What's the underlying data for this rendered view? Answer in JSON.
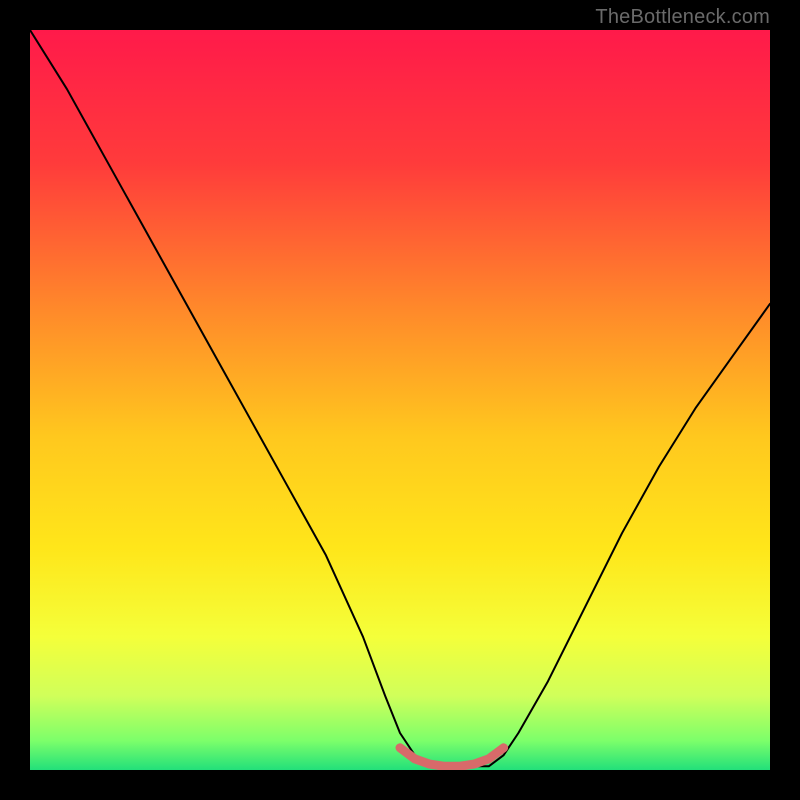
{
  "watermark": "TheBottleneck.com",
  "chart_data": {
    "type": "line",
    "title": "",
    "xlabel": "",
    "ylabel": "",
    "xlim": [
      0,
      100
    ],
    "ylim": [
      0,
      100
    ],
    "series": [
      {
        "name": "bottleneck-curve",
        "color": "#000000",
        "x": [
          0,
          5,
          10,
          15,
          20,
          25,
          30,
          35,
          40,
          45,
          48,
          50,
          52,
          55,
          58,
          60,
          62,
          64,
          66,
          70,
          75,
          80,
          85,
          90,
          95,
          100
        ],
        "y": [
          100,
          92,
          83,
          74,
          65,
          56,
          47,
          38,
          29,
          18,
          10,
          5,
          2,
          0.5,
          0.5,
          0.5,
          0.5,
          2,
          5,
          12,
          22,
          32,
          41,
          49,
          56,
          63
        ]
      },
      {
        "name": "optimal-band",
        "color": "#d86a6a",
        "x": [
          50,
          52,
          54,
          56,
          58,
          60,
          62,
          64
        ],
        "y": [
          3,
          1.5,
          0.8,
          0.5,
          0.5,
          0.8,
          1.5,
          3
        ]
      }
    ],
    "background_gradient": {
      "stops": [
        {
          "pos": 0.0,
          "color": "#ff1a4a"
        },
        {
          "pos": 0.18,
          "color": "#ff3b3b"
        },
        {
          "pos": 0.38,
          "color": "#ff8a2a"
        },
        {
          "pos": 0.55,
          "color": "#ffc81e"
        },
        {
          "pos": 0.7,
          "color": "#ffe61a"
        },
        {
          "pos": 0.82,
          "color": "#f4ff3a"
        },
        {
          "pos": 0.9,
          "color": "#d0ff5a"
        },
        {
          "pos": 0.96,
          "color": "#7dff6a"
        },
        {
          "pos": 1.0,
          "color": "#22e07a"
        }
      ]
    }
  }
}
